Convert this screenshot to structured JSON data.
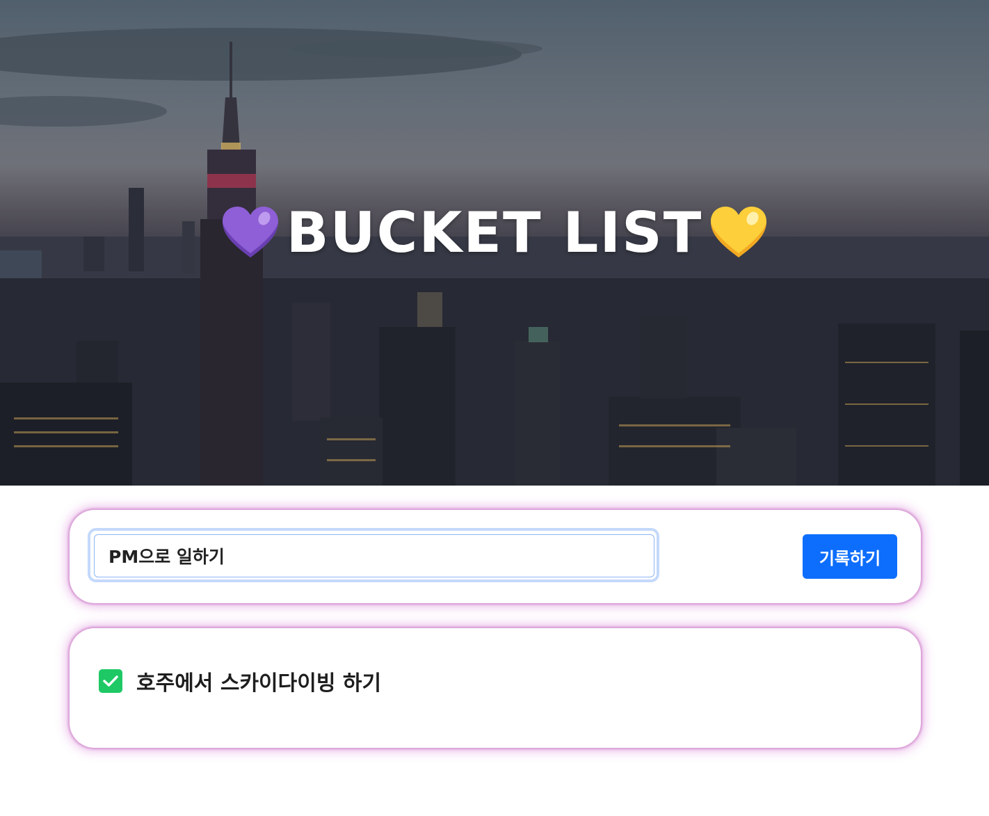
{
  "header": {
    "title": "BUCKET LIST",
    "left_icon": "purple-heart-icon",
    "right_icon": "yellow-heart-icon"
  },
  "form": {
    "input_value": "PM으로 일하기",
    "button_label": "기록하기"
  },
  "bucket_list": {
    "items": [
      {
        "text": "호주에서 스카이다이빙 하기",
        "done": true
      }
    ]
  },
  "colors": {
    "button": "#0d6efd",
    "check": "#1ec965",
    "card_glow": "#d596d2",
    "purple_heart": "#8e5fd6",
    "yellow_heart": "#fdcf3a"
  }
}
